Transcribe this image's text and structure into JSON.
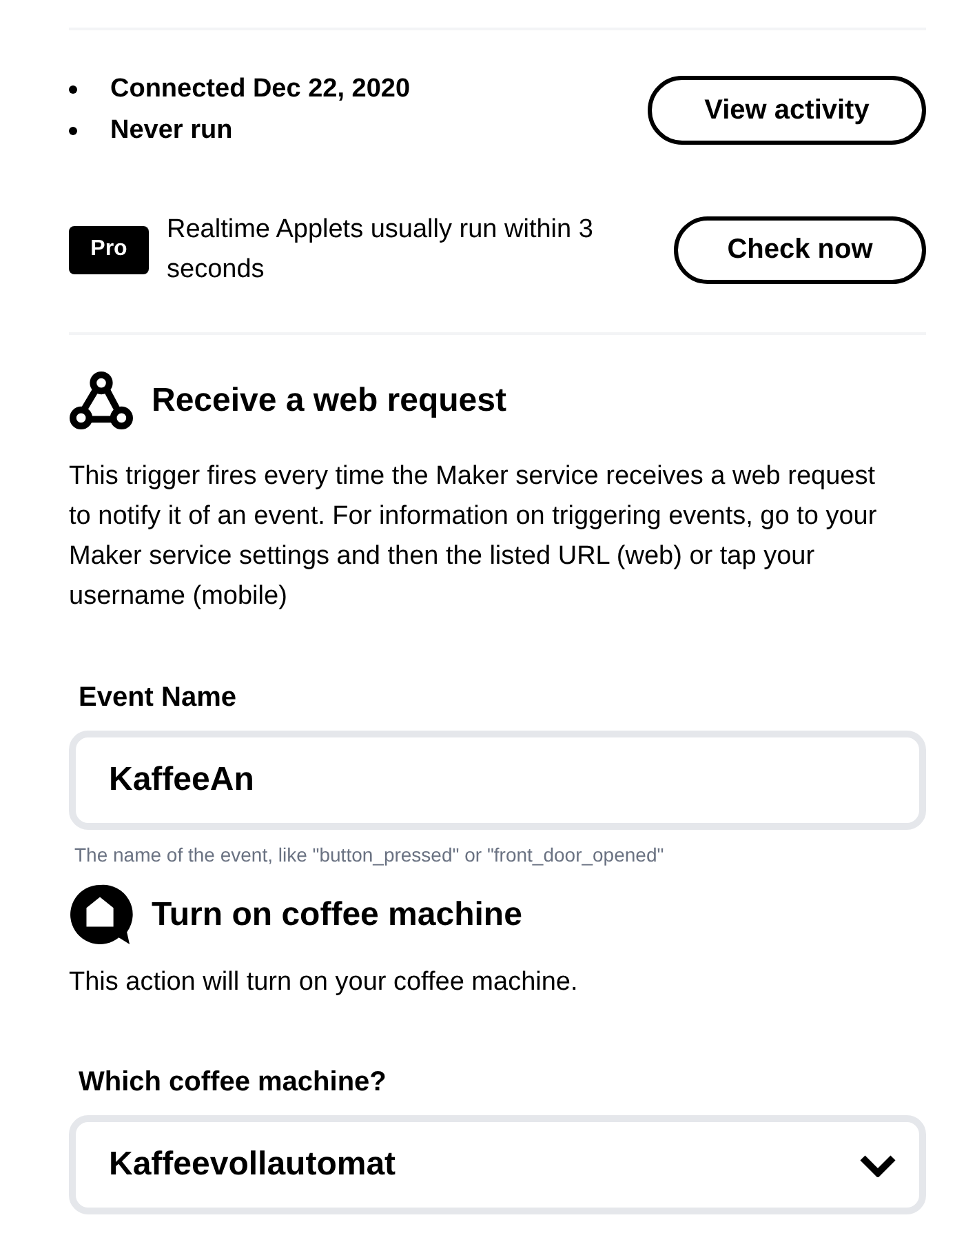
{
  "status": {
    "items": [
      "Connected Dec 22, 2020",
      "Never run"
    ],
    "button": "View activity"
  },
  "pro": {
    "badge": "Pro",
    "text": "Realtime Applets usually run within 3 seconds",
    "button": "Check now"
  },
  "trigger": {
    "title": "Receive a web request",
    "description": "This trigger fires every time the Maker service receives a web request to notify it of an event. For information on triggering events, go to your Maker service settings and then the listed URL (web) or tap your username (mobile)",
    "fields": [
      {
        "kind": "text",
        "label": "Event Name",
        "value": "KaffeeAn",
        "helper": "The name of the event, like \"button_pressed\" or \"front_door_opened\""
      }
    ]
  },
  "action": {
    "title": "Turn on coffee machine",
    "description": "This action will turn on your coffee machine.",
    "fields": [
      {
        "kind": "select",
        "label": "Which coffee machine?",
        "value": "Kaffeevollautomat"
      }
    ]
  }
}
